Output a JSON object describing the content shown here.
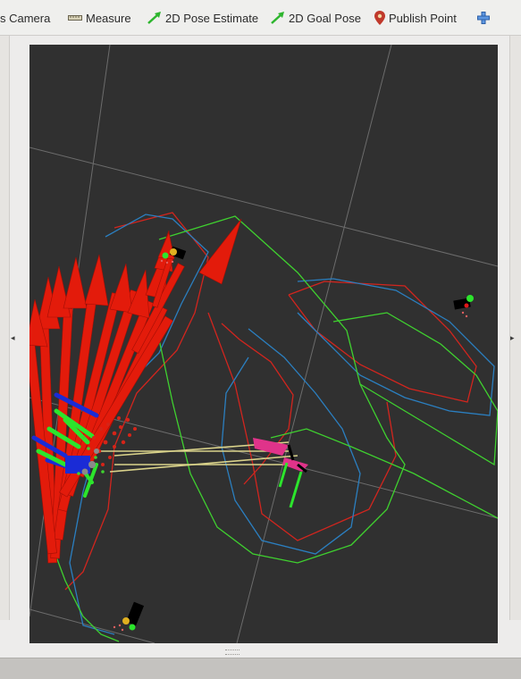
{
  "toolbar": {
    "camera_label": "s Camera",
    "measure_label": "Measure",
    "pose_estimate_label": "2D Pose Estimate",
    "goal_pose_label": "2D Goal Pose",
    "publish_point_label": "Publish Point"
  },
  "side_panels": {
    "left_arrow": "◂",
    "right_arrow": "▸"
  },
  "viewport": {
    "background": "#303030",
    "grid_color": "#777777"
  },
  "colors": {
    "arrow_red": "#e31b0b",
    "path_red": "#d2251e",
    "path_blue": "#2b7fc0",
    "path_green": "#3fd12f",
    "link_yellow": "#d9d28a",
    "marker_magenta": "#e0338a",
    "marker_green": "#2ce52c",
    "pose_icon_green": "#2db52d",
    "publish_icon": "#c0392b",
    "add_icon": "#3b7dd8"
  },
  "icons": [
    "camera-icon",
    "ruler-icon",
    "pose-estimate-arrow-icon",
    "goal-pose-arrow-icon",
    "map-pin-icon",
    "plus-icon"
  ]
}
